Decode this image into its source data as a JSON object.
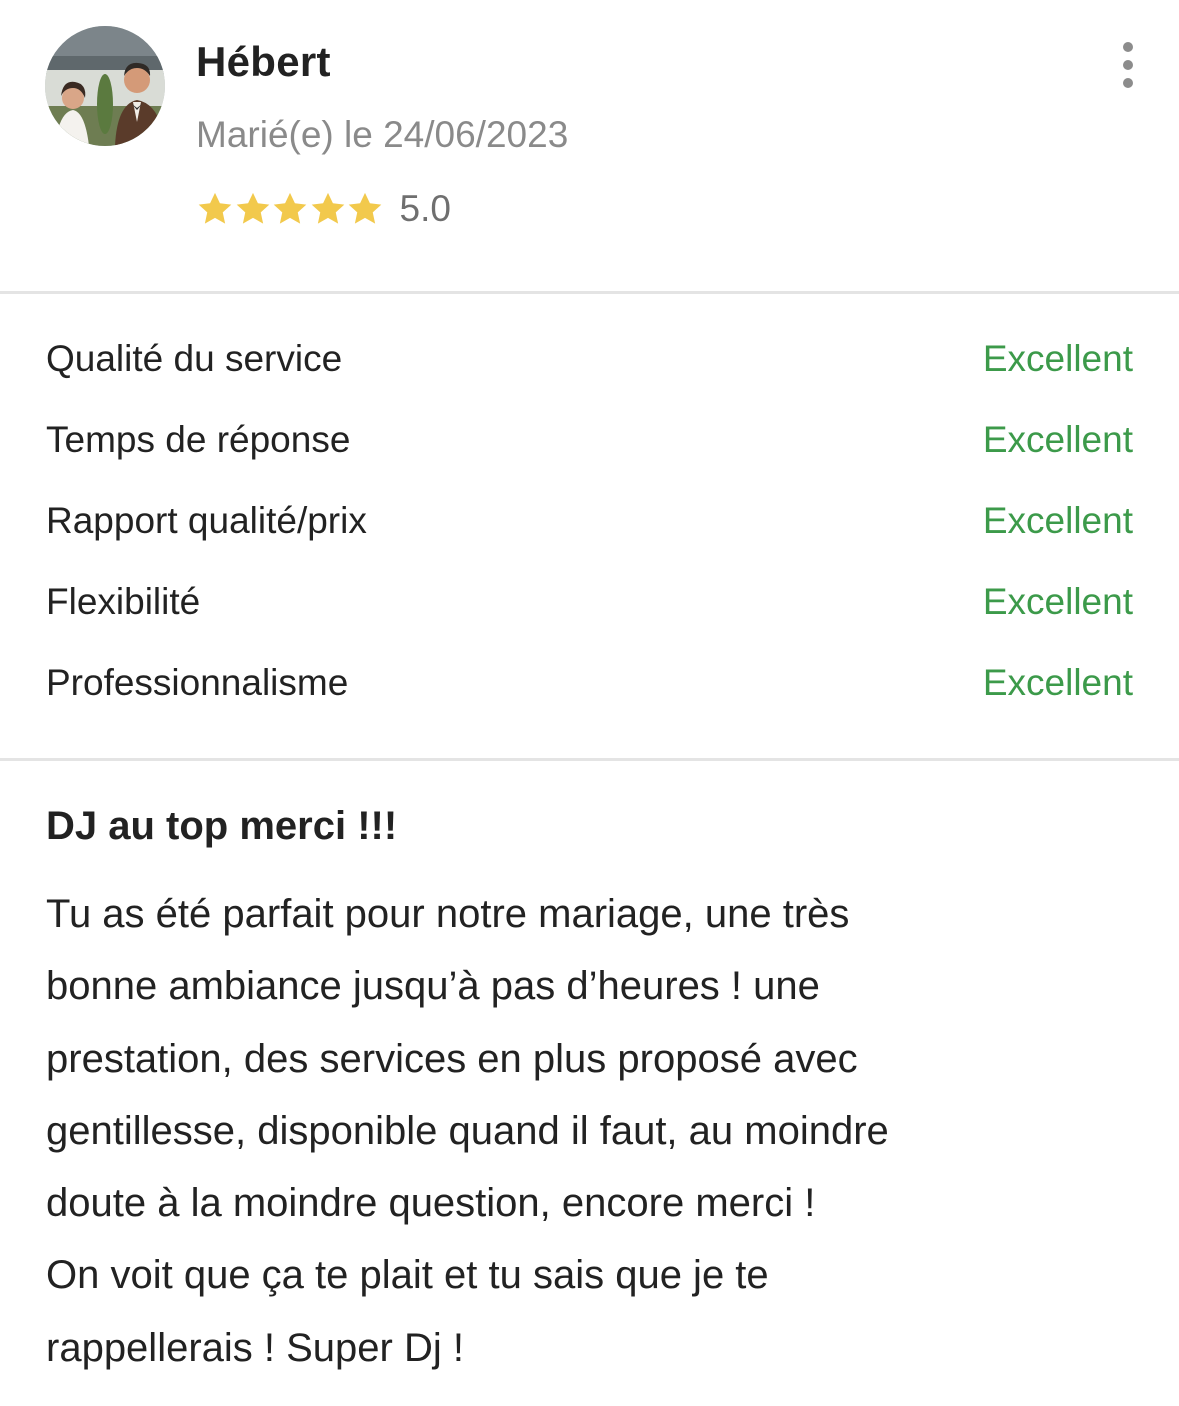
{
  "review": {
    "author": "Hébert",
    "married_date": "Marié(e) le 24/06/2023",
    "rating": "5.0",
    "rating_stars": 5,
    "avatar_icon": "couple-photo-avatar",
    "more_icon": "vertical-dots-icon"
  },
  "criteria": [
    {
      "label": "Qualité du service",
      "value": "Excellent"
    },
    {
      "label": "Temps de réponse",
      "value": "Excellent"
    },
    {
      "label": "Rapport qualité/prix",
      "value": "Excellent"
    },
    {
      "label": "Flexibilité",
      "value": "Excellent"
    },
    {
      "label": "Professionnalisme",
      "value": "Excellent"
    }
  ],
  "content": {
    "title": "DJ au top merci !!!",
    "body": "Tu as été parfait pour notre mariage, une très\nbonne ambiance jusqu’à pas d’heures ! une\nprestation, des services en plus proposé avec\ngentillesse, disponible quand il faut, au moindre\ndoute à la moindre question, encore merci !\nOn voit que ça te plait et tu sais que je te\nrappellerais ! Super Dj !"
  },
  "colors": {
    "star": "#F2C94C",
    "positive": "#3C9A4A",
    "muted_text": "#8A8A8A",
    "divider": "#E4E4E4"
  }
}
